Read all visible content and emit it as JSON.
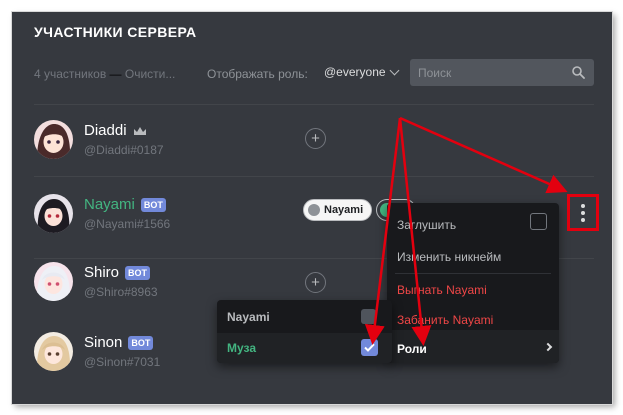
{
  "header": {
    "title": "УЧАСТНИКИ СЕРВЕРА",
    "member_count": "4 участников",
    "separator": " — ",
    "prune_link": "Очисти...",
    "role_filter_label": "Отображать роль:",
    "role_filter_value": "@everyone",
    "search_placeholder": "Поиск"
  },
  "members": [
    {
      "name": "Diaddi",
      "tag": "@Diaddi#0187",
      "owner": true,
      "bot": false
    },
    {
      "name": "Nayami",
      "tag": "@Nayami#1566",
      "owner": false,
      "bot": true,
      "bot_label": "BOT",
      "role": "Nayami"
    },
    {
      "name": "Shiro",
      "tag": "@Shiro#8963",
      "owner": false,
      "bot": true,
      "bot_label": "BOT"
    },
    {
      "name": "Sinon",
      "tag": "@Sinon#7031",
      "owner": false,
      "bot": true,
      "bot_label": "BOT"
    }
  ],
  "context_menu": {
    "mute": "Заглушить",
    "change_nickname": "Изменить никнейм",
    "kick": "Выгнать Nayami",
    "ban": "Забанить Nayami",
    "roles": "Роли"
  },
  "roles_submenu": {
    "items": [
      {
        "label": "Nayami",
        "checked": false
      },
      {
        "label": "Муза",
        "checked": true
      }
    ]
  },
  "colors": {
    "background": "#36393f",
    "menu": "#18191c",
    "accent": "#7289da",
    "danger": "#f04747",
    "online": "#43b581",
    "annotation": "#e3000f"
  }
}
